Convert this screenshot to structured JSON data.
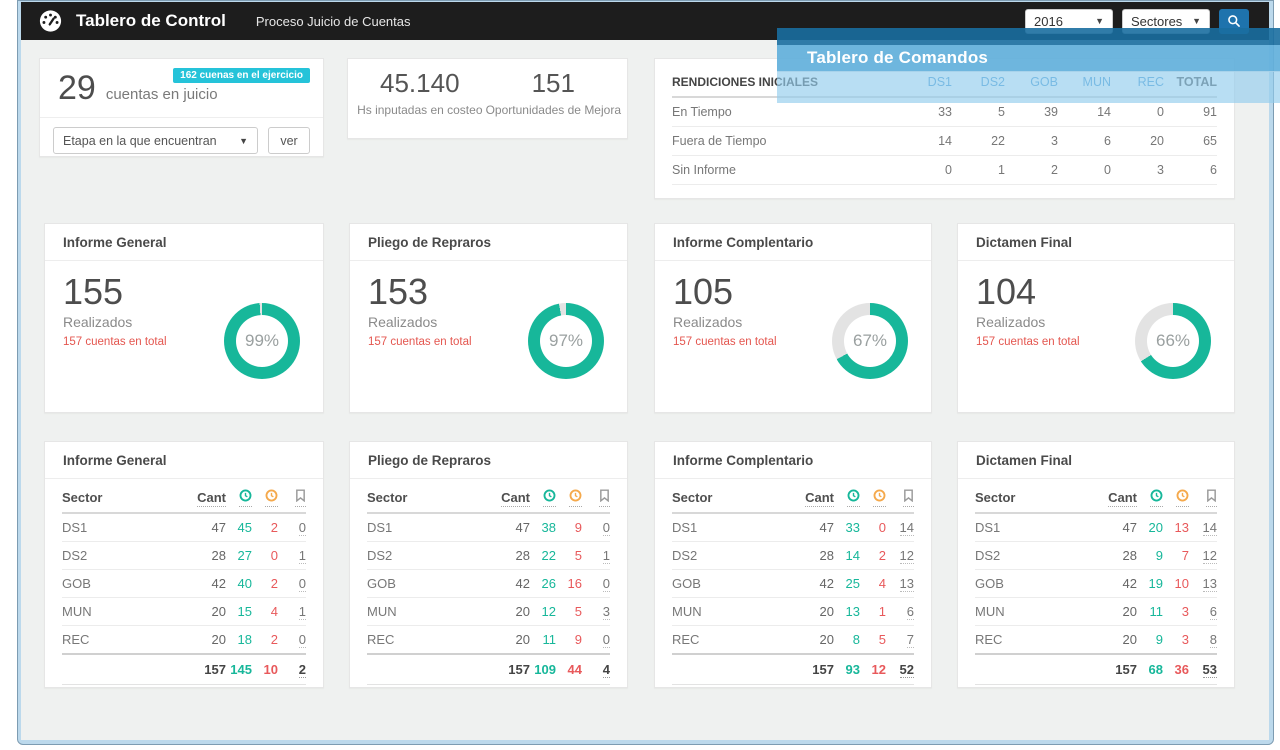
{
  "overlay": {
    "title": "Tablero de Comandos"
  },
  "header": {
    "app_title": "Tablero de Control",
    "app_subtitle": "Proceso Juicio de Cuentas",
    "year_value": "2016",
    "sectors_value": "Sectores"
  },
  "juicio_card": {
    "value": "29",
    "label": "cuentas en juicio",
    "badge": "162 cuenas en el ejercicio",
    "stage_select": "Etapa en la que encuentran",
    "view_button": "ver"
  },
  "costeo_card": {
    "hours_value": "45.140",
    "hours_label": "Hs inputadas en costeo",
    "improve_value": "151",
    "improve_label": "Oportunidades de Mejora"
  },
  "rendiciones": {
    "title": "RENDICIONES INICIALES",
    "columns": [
      "DS1",
      "DS2",
      "GOB",
      "MUN",
      "REC",
      "TOTAL"
    ],
    "rows": [
      {
        "label": "En Tiempo",
        "values": [
          "33",
          "5",
          "39",
          "14",
          "0",
          "91"
        ]
      },
      {
        "label": "Fuera de Tiempo",
        "values": [
          "14",
          "22",
          "3",
          "6",
          "20",
          "65"
        ]
      },
      {
        "label": "Sin Informe",
        "values": [
          "0",
          "1",
          "2",
          "0",
          "3",
          "6"
        ]
      }
    ]
  },
  "donut_cards": [
    {
      "title": "Informe General",
      "value": "155",
      "label": "Realizados",
      "total_label": "157 cuentas en total",
      "percent": 99,
      "percent_label": "99%"
    },
    {
      "title": "Pliego de Repraros",
      "value": "153",
      "label": "Realizados",
      "total_label": "157 cuentas en total",
      "percent": 97,
      "percent_label": "97%"
    },
    {
      "title": "Informe Complentario",
      "value": "105",
      "label": "Realizados",
      "total_label": "157 cuentas en total",
      "percent": 67,
      "percent_label": "67%"
    },
    {
      "title": "Dictamen Final",
      "value": "104",
      "label": "Realizados",
      "total_label": "157 cuentas en total",
      "percent": 66,
      "percent_label": "66%"
    }
  ],
  "sector_tables": [
    {
      "title": "Informe General",
      "col_sector": "Sector",
      "col_cant": "Cant",
      "rows": [
        {
          "sector": "DS1",
          "cant": "47",
          "ok": "45",
          "late": "2",
          "flag": "0"
        },
        {
          "sector": "DS2",
          "cant": "28",
          "ok": "27",
          "late": "0",
          "flag": "1"
        },
        {
          "sector": "GOB",
          "cant": "42",
          "ok": "40",
          "late": "2",
          "flag": "0"
        },
        {
          "sector": "MUN",
          "cant": "20",
          "ok": "15",
          "late": "4",
          "flag": "1"
        },
        {
          "sector": "REC",
          "cant": "20",
          "ok": "18",
          "late": "2",
          "flag": "0"
        }
      ],
      "totals": {
        "cant": "157",
        "ok": "145",
        "late": "10",
        "flag": "2"
      }
    },
    {
      "title": "Pliego de Repraros",
      "col_sector": "Sector",
      "col_cant": "Cant",
      "rows": [
        {
          "sector": "DS1",
          "cant": "47",
          "ok": "38",
          "late": "9",
          "flag": "0"
        },
        {
          "sector": "DS2",
          "cant": "28",
          "ok": "22",
          "late": "5",
          "flag": "1"
        },
        {
          "sector": "GOB",
          "cant": "42",
          "ok": "26",
          "late": "16",
          "flag": "0"
        },
        {
          "sector": "MUN",
          "cant": "20",
          "ok": "12",
          "late": "5",
          "flag": "3"
        },
        {
          "sector": "REC",
          "cant": "20",
          "ok": "11",
          "late": "9",
          "flag": "0"
        }
      ],
      "totals": {
        "cant": "157",
        "ok": "109",
        "late": "44",
        "flag": "4"
      }
    },
    {
      "title": "Informe Complentario",
      "col_sector": "Sector",
      "col_cant": "Cant",
      "rows": [
        {
          "sector": "DS1",
          "cant": "47",
          "ok": "33",
          "late": "0",
          "flag": "14"
        },
        {
          "sector": "DS2",
          "cant": "28",
          "ok": "14",
          "late": "2",
          "flag": "12"
        },
        {
          "sector": "GOB",
          "cant": "42",
          "ok": "25",
          "late": "4",
          "flag": "13"
        },
        {
          "sector": "MUN",
          "cant": "20",
          "ok": "13",
          "late": "1",
          "flag": "6"
        },
        {
          "sector": "REC",
          "cant": "20",
          "ok": "8",
          "late": "5",
          "flag": "7"
        }
      ],
      "totals": {
        "cant": "157",
        "ok": "93",
        "late": "12",
        "flag": "52"
      }
    },
    {
      "title": "Dictamen Final",
      "col_sector": "Sector",
      "col_cant": "Cant",
      "rows": [
        {
          "sector": "DS1",
          "cant": "47",
          "ok": "20",
          "late": "13",
          "flag": "14"
        },
        {
          "sector": "DS2",
          "cant": "28",
          "ok": "9",
          "late": "7",
          "flag": "12"
        },
        {
          "sector": "GOB",
          "cant": "42",
          "ok": "19",
          "late": "10",
          "flag": "13"
        },
        {
          "sector": "MUN",
          "cant": "20",
          "ok": "11",
          "late": "3",
          "flag": "6"
        },
        {
          "sector": "REC",
          "cant": "20",
          "ok": "9",
          "late": "3",
          "flag": "8"
        }
      ],
      "totals": {
        "cant": "157",
        "ok": "68",
        "late": "36",
        "flag": "53"
      }
    }
  ],
  "colors": {
    "accent_green": "#17b79a",
    "accent_red": "#e8595b",
    "accent_blue": "#4a9ad4",
    "badge_cyan": "#25c3d9",
    "header_dark": "#1d1d1d",
    "search_blue": "#1e73ad",
    "overlay_blue": "#62b0db"
  }
}
